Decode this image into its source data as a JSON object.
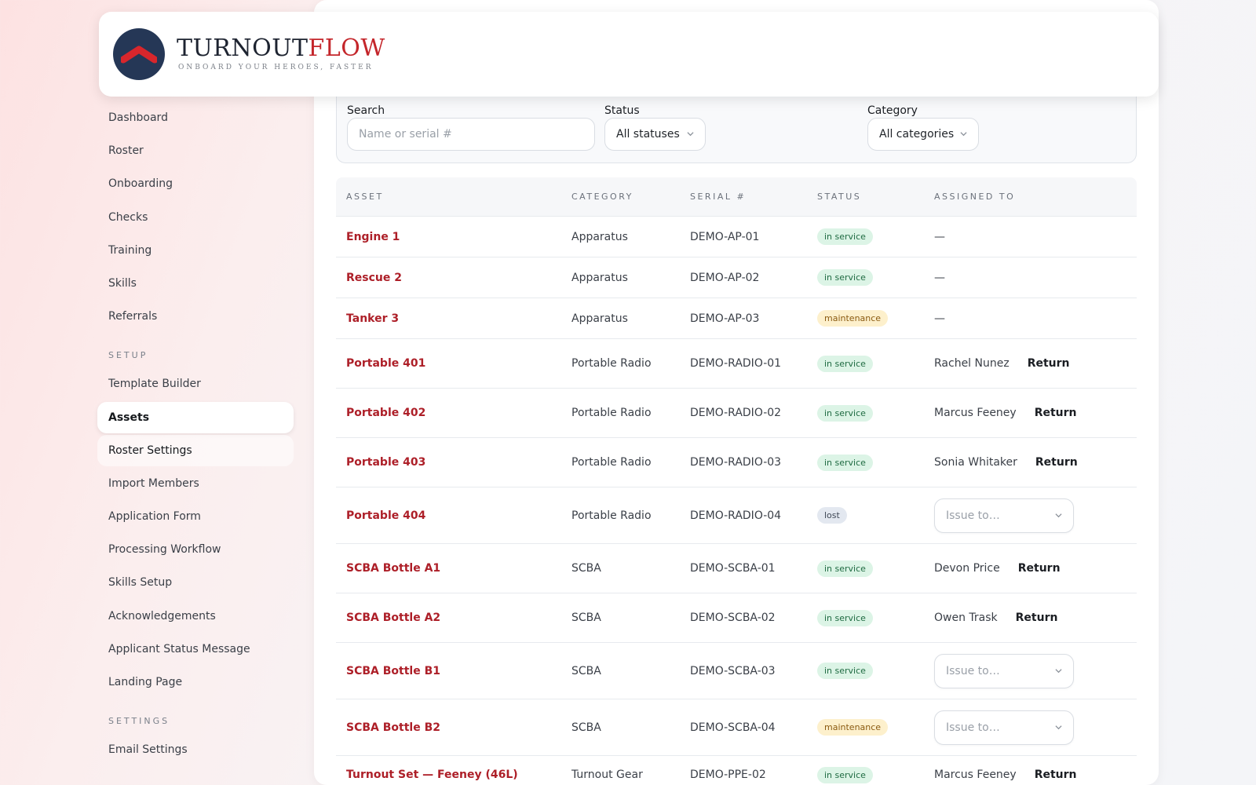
{
  "brand": {
    "name_part1": "TURNOUT",
    "name_part2": "FLOW",
    "tagline": "ONBOARD YOUR HEROES, FASTER"
  },
  "sidebar": {
    "items": [
      {
        "label": "Dashboard"
      },
      {
        "label": "Roster"
      },
      {
        "label": "Onboarding"
      },
      {
        "label": "Checks"
      },
      {
        "label": "Training"
      },
      {
        "label": "Skills"
      },
      {
        "label": "Referrals"
      }
    ],
    "setup_label": "SETUP",
    "setup_items": [
      {
        "label": "Template Builder"
      },
      {
        "label": "Assets"
      },
      {
        "label": "Roster Settings"
      },
      {
        "label": "Import Members"
      },
      {
        "label": "Application Form"
      },
      {
        "label": "Processing Workflow"
      },
      {
        "label": "Skills Setup"
      },
      {
        "label": "Acknowledgements"
      },
      {
        "label": "Applicant Status Message"
      },
      {
        "label": "Landing Page"
      }
    ],
    "settings_label": "SETTINGS",
    "settings_items": [
      {
        "label": "Email Settings"
      }
    ]
  },
  "filters": {
    "search_label": "Search",
    "search_placeholder": "Name or serial #",
    "status_label": "Status",
    "status_value": "All statuses",
    "category_label": "Category",
    "category_value": "All categories"
  },
  "table": {
    "headers": {
      "asset": "ASSET",
      "category": "CATEGORY",
      "serial": "SERIAL #",
      "status": "STATUS",
      "assigned": "ASSIGNED TO"
    },
    "return_label": "Return",
    "issue_placeholder": "Issue to…",
    "rows": [
      {
        "asset": "Engine 1",
        "category": "Apparatus",
        "serial": "DEMO-AP-01",
        "status": "in service",
        "assigned": "—"
      },
      {
        "asset": "Rescue 2",
        "category": "Apparatus",
        "serial": "DEMO-AP-02",
        "status": "in service",
        "assigned": "—"
      },
      {
        "asset": "Tanker 3",
        "category": "Apparatus",
        "serial": "DEMO-AP-03",
        "status": "maintenance",
        "assigned": "—"
      },
      {
        "asset": "Portable 401",
        "category": "Portable Radio",
        "serial": "DEMO-RADIO-01",
        "status": "in service",
        "assigned": "Rachel Nunez"
      },
      {
        "asset": "Portable 402",
        "category": "Portable Radio",
        "serial": "DEMO-RADIO-02",
        "status": "in service",
        "assigned": "Marcus Feeney"
      },
      {
        "asset": "Portable 403",
        "category": "Portable Radio",
        "serial": "DEMO-RADIO-03",
        "status": "in service",
        "assigned": "Sonia Whitaker"
      },
      {
        "asset": "Portable 404",
        "category": "Portable Radio",
        "serial": "DEMO-RADIO-04",
        "status": "lost",
        "assigned": ""
      },
      {
        "asset": "SCBA Bottle A1",
        "category": "SCBA",
        "serial": "DEMO-SCBA-01",
        "status": "in service",
        "assigned": "Devon Price"
      },
      {
        "asset": "SCBA Bottle A2",
        "category": "SCBA",
        "serial": "DEMO-SCBA-02",
        "status": "in service",
        "assigned": "Owen Trask"
      },
      {
        "asset": "SCBA Bottle B1",
        "category": "SCBA",
        "serial": "DEMO-SCBA-03",
        "status": "in service",
        "assigned": ""
      },
      {
        "asset": "SCBA Bottle B2",
        "category": "SCBA",
        "serial": "DEMO-SCBA-04",
        "status": "maintenance",
        "assigned": ""
      },
      {
        "asset": "Turnout Set — Feeney (46L)",
        "category": "Turnout Gear",
        "serial": "DEMO-PPE-02",
        "status": "in service",
        "assigned": "Marcus Feeney"
      }
    ]
  },
  "colors": {
    "accent": "#c4262b",
    "asset_link": "#ad1f28",
    "logo_bg": "#253756",
    "in_service_bg": "#dcf4e6",
    "maintenance_bg": "#fdf0cc",
    "lost_bg": "#e3e8f0"
  },
  "icons": {
    "logo": "chevron-up-logo-icon",
    "dropdown": "chevron-down-icon"
  }
}
